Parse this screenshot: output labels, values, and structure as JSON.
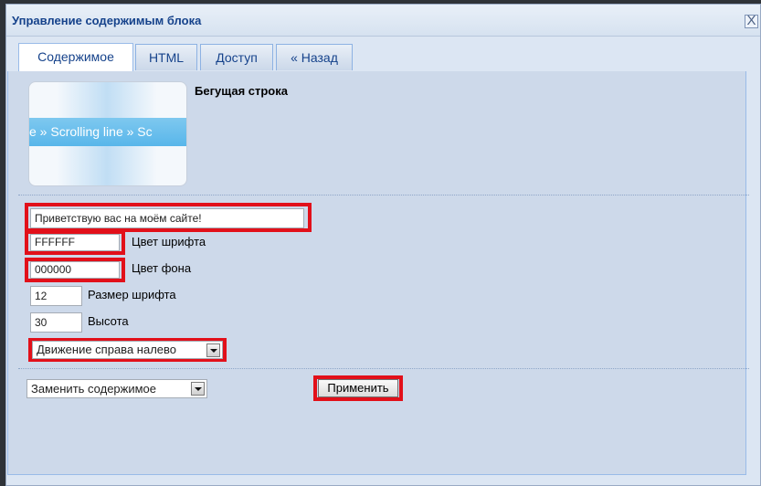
{
  "window": {
    "title": "Управление содержимым блока",
    "close_label": "X"
  },
  "tabs": [
    {
      "label": "Содержимое"
    },
    {
      "label": "HTML"
    },
    {
      "label": "Доступ"
    },
    {
      "label": "« Назад"
    }
  ],
  "preview": {
    "band_text": "e » Scrolling line » Sc",
    "title": "Бегущая строка"
  },
  "form": {
    "text_value": "Приветствую вас на моём сайте!",
    "font_color": {
      "value": "FFFFFF",
      "label": "Цвет шрифта"
    },
    "bg_color": {
      "value": "000000",
      "label": "Цвет фона"
    },
    "font_size": {
      "value": "12",
      "label": "Размер шрифта"
    },
    "height": {
      "value": "30",
      "label": "Высота"
    },
    "direction": {
      "selected": "Движение справа налево"
    }
  },
  "footer": {
    "replace_select": "Заменить содержимое",
    "apply_label": "Применить"
  },
  "colors": {
    "highlight": "#e2101a",
    "title": "#15428b"
  }
}
